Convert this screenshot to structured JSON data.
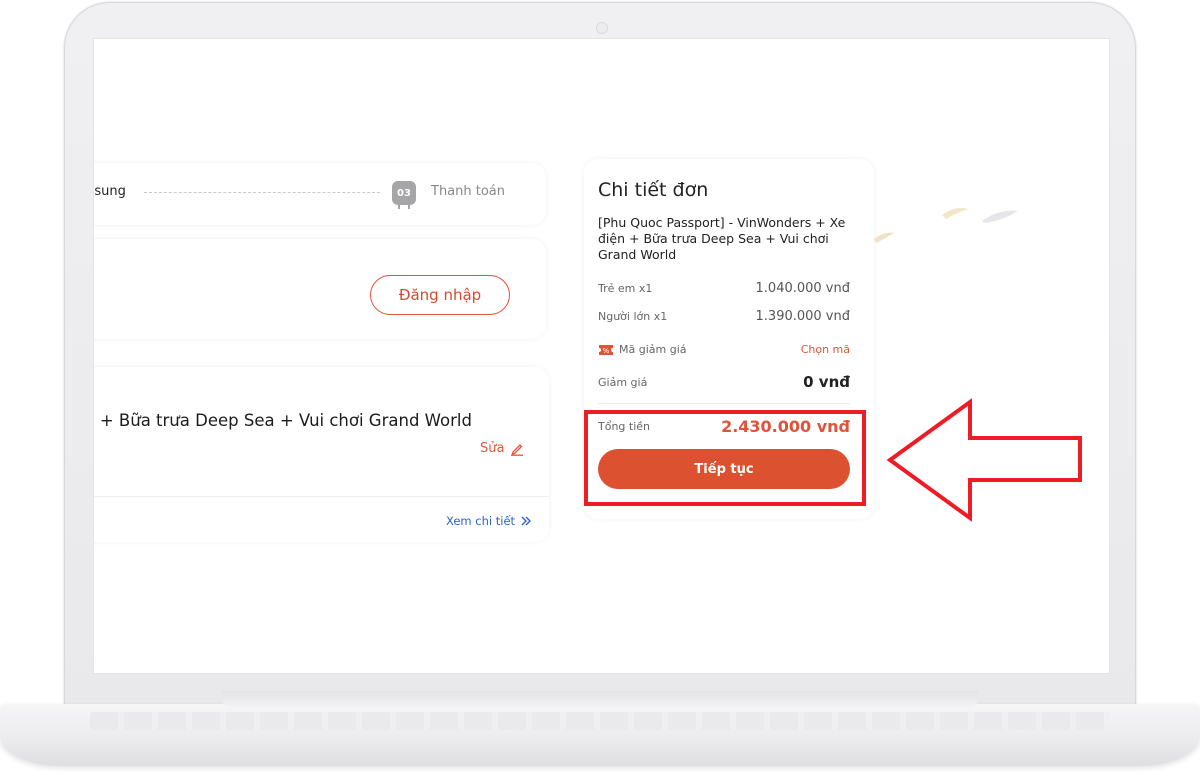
{
  "steps": {
    "previous_label": "bổ sung",
    "current_number": "03",
    "current_label": "Thanh toán"
  },
  "login": {
    "button_label": "Đăng nhập"
  },
  "product": {
    "title": "ện + Bữa trưa Deep Sea + Vui chơi Grand World",
    "edit_label": "Sửa",
    "detail_link_label": "Xem chi tiết"
  },
  "order": {
    "title": "Chi tiết đơn",
    "product_name": "[Phu Quoc Passport] - VinWonders + Xe điện + Bữa trưa Deep Sea + Vui chơi Grand World",
    "lines": [
      {
        "label": "Trẻ em x1",
        "value": "1.040.000 vnđ"
      },
      {
        "label": "Người lớn x1",
        "value": "1.390.000 vnđ"
      }
    ],
    "coupon_label": "Mã giảm giá",
    "coupon_action": "Chọn mã",
    "discount_label": "Giảm giá",
    "discount_value": "0 vnđ",
    "total_label": "Tổng tiền",
    "total_value": "2.430.000 vnđ",
    "continue_label": "Tiếp tục"
  },
  "colors": {
    "accent": "#dc5130",
    "highlight": "#ee1c24",
    "link": "#2b63c9"
  },
  "icons": [
    "edit-pencil-icon",
    "double-chevron-right-icon",
    "coupon-ticket-icon",
    "step-bus-icon",
    "annotation-arrow-left"
  ]
}
